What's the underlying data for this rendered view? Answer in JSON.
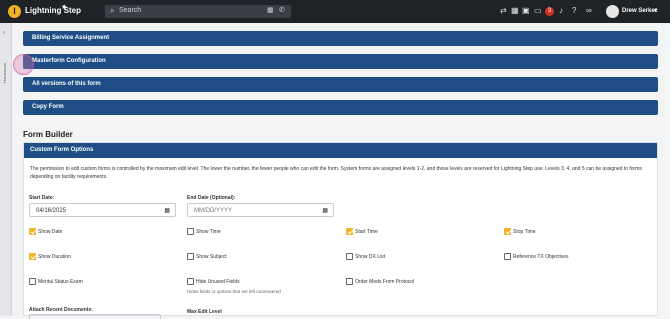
{
  "topbar": {
    "logo_letter": "l",
    "app_name": "Lightning Step",
    "star_icon": "★",
    "search_placeholder": "Search",
    "user_name": "Drew Serkez",
    "notification_count": "3",
    "icons": [
      "refresh-icon",
      "calendar-icon",
      "grid-icon",
      "chat-icon",
      "bell-icon",
      "help-icon",
      "link-icon"
    ]
  },
  "sidebar": {
    "label": "Homeroom"
  },
  "panels": [
    {
      "label": "Billing Service Assignment"
    },
    {
      "label": "Masterform Configuration"
    },
    {
      "label": "All versions of this form"
    },
    {
      "label": "Copy Form"
    }
  ],
  "form_builder": {
    "title": "Form Builder",
    "card_title": "Custom Form Options",
    "permission_note": "The permission to edit custom forms is controlled by the maximum edit level. The lower the number, the fewer people who can edit the form. System forms are assigned levels 1-2, and those levels are reserved for Lightning Step use. Levels 3, 4, and 5 can be assigned to forms depending on facility requirements.",
    "start_date_label": "Start Date:",
    "start_date_value": "04/16/2025",
    "end_date_label": "End Date (Optional):",
    "end_date_placeholder": "MM/DD/YYYY",
    "checkboxes": [
      {
        "label": "Show Date",
        "checked": true
      },
      {
        "label": "Show Time",
        "checked": false
      },
      {
        "label": "Start Time",
        "checked": true
      },
      {
        "label": "Stop Time",
        "checked": true
      },
      {
        "label": "Show Duration",
        "checked": true
      },
      {
        "label": "Show Subject",
        "checked": false
      },
      {
        "label": "Show DX List",
        "checked": false
      },
      {
        "label": "Reference TX Objectives",
        "checked": false
      },
      {
        "label": "Mental Status Exam",
        "checked": false
      },
      {
        "label": "Hide Unused Fields",
        "checked": false
      },
      {
        "label": "Order Meds From Protocol",
        "checked": false
      }
    ],
    "hide_unused_hint": "Hides fields or options that are left unanswered",
    "attach_docs_label": "Attach Recent Documents:",
    "max_edit_label": "Max Edit Level"
  }
}
